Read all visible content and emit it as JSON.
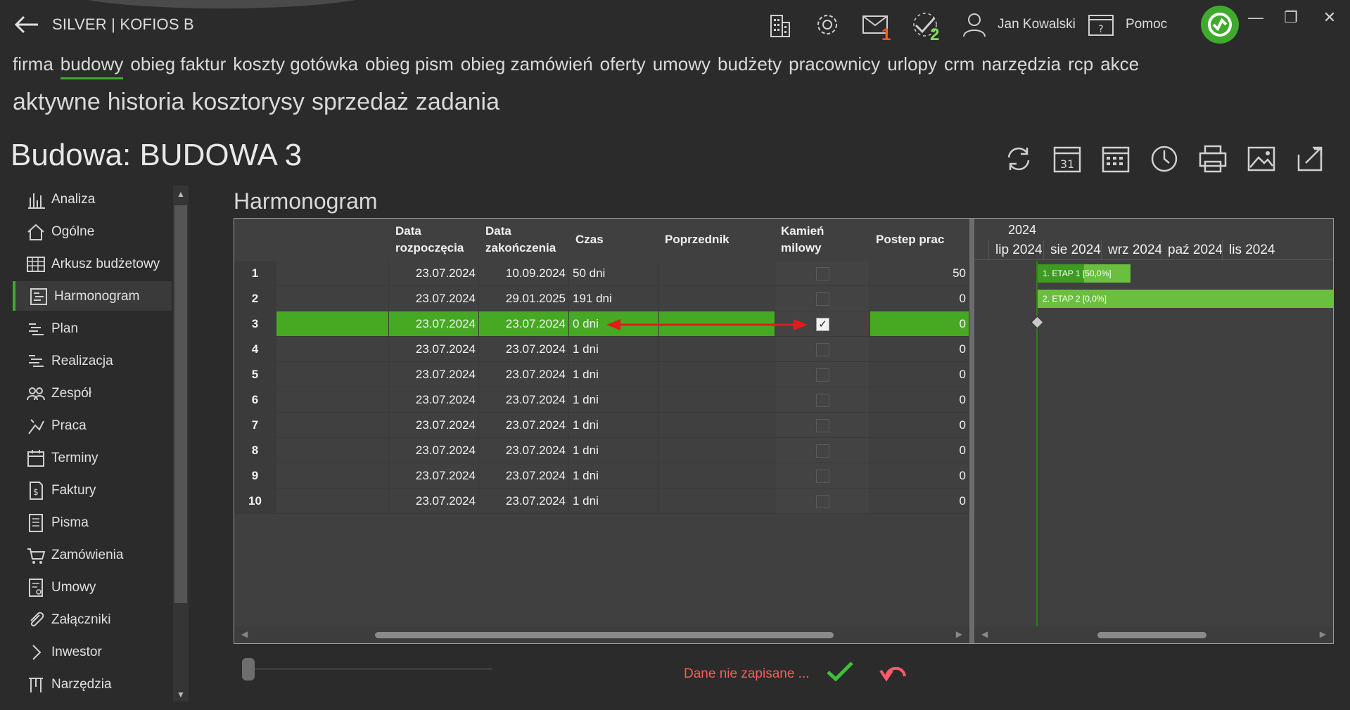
{
  "app": {
    "title": "SILVER | KOFIOS B",
    "user_name": "Jan Kowalski",
    "help_label": "Pomoc"
  },
  "badges": {
    "mail_count": "1",
    "tasks_count": "2"
  },
  "colors": {
    "accent": "#3faa2e",
    "row_highlight": "#46a823",
    "mail_badge": "#ff5a1f",
    "tasks_badge": "#7ee15a",
    "warning": "#ff5a5a"
  },
  "main_nav": [
    "firma",
    "budowy",
    "obieg faktur",
    "koszty gotówka",
    "obieg pism",
    "obieg zamówień",
    "oferty",
    "umowy",
    "budżety",
    "pracownicy",
    "urlopy",
    "crm",
    "narzędzia",
    "rcp",
    "akce"
  ],
  "sub_nav": [
    "aktywne",
    "historia",
    "kosztorysy",
    "sprzedaż",
    "zadania"
  ],
  "page_title": "Budowa: BUDOWA 3",
  "sidebar": [
    {
      "label": "Analiza",
      "icon": "bar-chart-icon"
    },
    {
      "label": "Ogólne",
      "icon": "home-icon"
    },
    {
      "label": "Arkusz budżetowy",
      "icon": "spreadsheet-icon"
    },
    {
      "label": "Harmonogram",
      "icon": "schedule-icon",
      "active": true
    },
    {
      "label": "Plan",
      "icon": "plan-icon"
    },
    {
      "label": "Realizacja",
      "icon": "realization-icon"
    },
    {
      "label": "Zespół",
      "icon": "team-icon"
    },
    {
      "label": "Praca",
      "icon": "work-icon"
    },
    {
      "label": "Terminy",
      "icon": "calendar-icon"
    },
    {
      "label": "Faktury",
      "icon": "invoice-icon"
    },
    {
      "label": "Pisma",
      "icon": "document-icon"
    },
    {
      "label": "Zamówienia",
      "icon": "cart-icon"
    },
    {
      "label": "Umowy",
      "icon": "contract-icon"
    },
    {
      "label": "Załączniki",
      "icon": "paperclip-icon"
    },
    {
      "label": "Inwestor",
      "icon": "chevron-right-icon"
    },
    {
      "label": "Narzędzia",
      "icon": "tools-icon"
    }
  ],
  "section_title": "Harmonogram",
  "table": {
    "headers": {
      "name": "",
      "start_line1": "Data",
      "start_line2": "rozpoczęcia",
      "end_line1": "Data",
      "end_line2": "zakończenia",
      "duration": "Czas",
      "predecessor": "Poprzednik",
      "milestone_line1": "Kamień",
      "milestone_line2": "milowy",
      "progress": "Postep prac"
    },
    "rows": [
      {
        "num": "1",
        "name": "",
        "start": "23.07.2024",
        "end": "10.09.2024",
        "duration": "50 dni",
        "predecessor": "",
        "milestone": false,
        "progress": "50"
      },
      {
        "num": "2",
        "name": "",
        "start": "23.07.2024",
        "end": "29.01.2025",
        "duration": "191 dni",
        "predecessor": "",
        "milestone": false,
        "progress": "0"
      },
      {
        "num": "3",
        "name": "",
        "start": "23.07.2024",
        "end": "23.07.2024",
        "duration": "0 dni",
        "predecessor": "",
        "milestone": true,
        "progress": "0",
        "selected": true
      },
      {
        "num": "4",
        "name": "",
        "start": "23.07.2024",
        "end": "23.07.2024",
        "duration": "1 dni",
        "predecessor": "",
        "milestone": false,
        "progress": "0"
      },
      {
        "num": "5",
        "name": "",
        "start": "23.07.2024",
        "end": "23.07.2024",
        "duration": "1 dni",
        "predecessor": "",
        "milestone": false,
        "progress": "0"
      },
      {
        "num": "6",
        "name": "",
        "start": "23.07.2024",
        "end": "23.07.2024",
        "duration": "1 dni",
        "predecessor": "",
        "milestone": false,
        "progress": "0"
      },
      {
        "num": "7",
        "name": "",
        "start": "23.07.2024",
        "end": "23.07.2024",
        "duration": "1 dni",
        "predecessor": "",
        "milestone": false,
        "progress": "0"
      },
      {
        "num": "8",
        "name": "",
        "start": "23.07.2024",
        "end": "23.07.2024",
        "duration": "1 dni",
        "predecessor": "",
        "milestone": false,
        "progress": "0"
      },
      {
        "num": "9",
        "name": "",
        "start": "23.07.2024",
        "end": "23.07.2024",
        "duration": "1 dni",
        "predecessor": "",
        "milestone": false,
        "progress": "0"
      },
      {
        "num": "10",
        "name": "",
        "start": "23.07.2024",
        "end": "23.07.2024",
        "duration": "1 dni",
        "predecessor": "",
        "milestone": false,
        "progress": "0"
      }
    ]
  },
  "gantt": {
    "year": "2024",
    "months": [
      "lip 2024",
      "sie 2024",
      "wrz 2024",
      "paź 2024",
      "lis 2024"
    ],
    "bars": [
      {
        "label": "1. ETAP 1 [50,0%]",
        "progress": 0.5
      },
      {
        "label": "2. ETAP 2 [0,0%]",
        "progress": 0
      }
    ]
  },
  "footer": {
    "status_text": "Dane nie zapisane ..."
  }
}
